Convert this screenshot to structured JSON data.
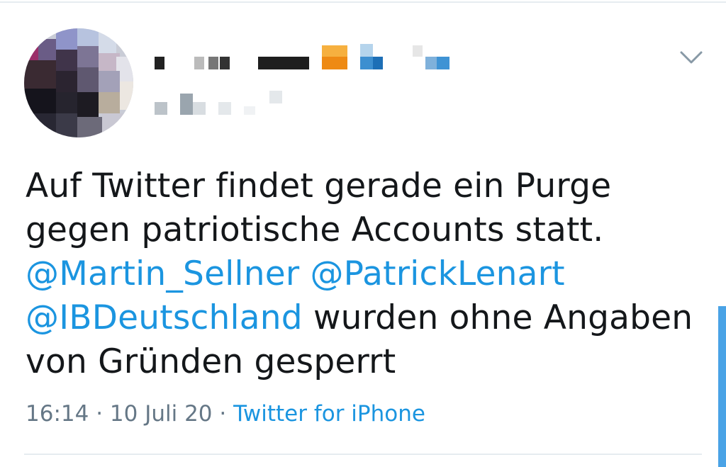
{
  "tweet": {
    "text_parts": {
      "intro": "Auf Twitter findet gerade ein Purge gegen patriotische Accounts statt. ",
      "mention_1": "@Martin​_Sellner",
      "space_1": " ",
      "mention_2": "@PatrickLenart",
      "space_2": " ",
      "mention_3": "@IBDeutschland",
      "outro": " wurden ohne Angaben von Gründen gesperrt"
    },
    "timestamp": "16:14 · 10 Juli 20",
    "separator": " · ",
    "source": "Twitter for iPhone"
  },
  "colors": {
    "text": "#14171a",
    "link": "#1b95e0",
    "meta": "#657786",
    "divider": "#e6ecf0"
  },
  "icons": {
    "more_menu": "chevron-down-icon"
  }
}
